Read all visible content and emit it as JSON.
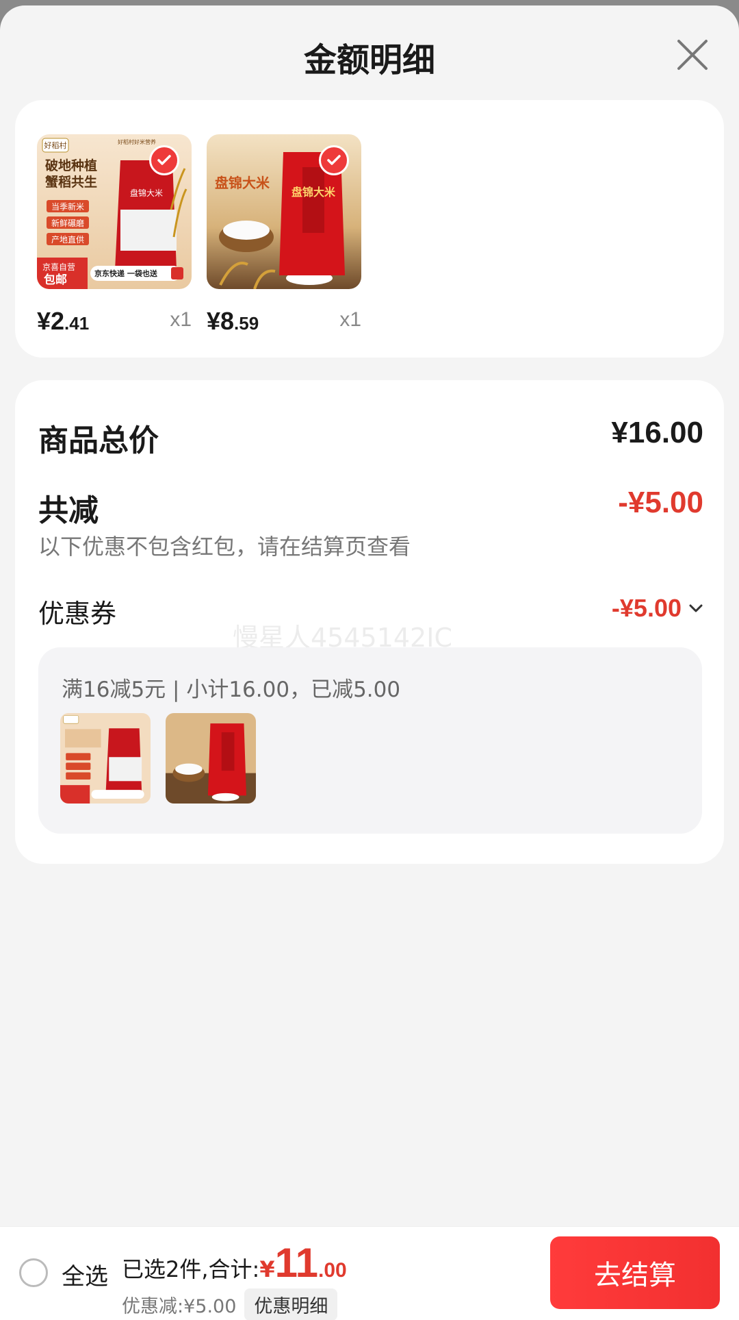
{
  "header": {
    "title": "金额明细",
    "close_icon": "close-icon"
  },
  "products": [
    {
      "pack_brand": "好稻村",
      "slogan_line1": "破地种植",
      "slogan_line2": "蟹稻共生",
      "tags": [
        "当季新米",
        "新鲜碾磨",
        "产地直供"
      ],
      "bag_label": "盘锦大米",
      "corner_badge_line1": "京喜自营",
      "corner_badge_line2": "包邮",
      "delivery_text": "京东快递 一袋也送",
      "top_banner": "好稻村好米营养",
      "price_int": "¥2",
      "price_dec": ".41",
      "qty": "x1",
      "selected_icon": "check-icon"
    },
    {
      "headline": "盘锦大米",
      "bag_label": "盘锦大米",
      "price_int": "¥8",
      "price_dec": ".59",
      "qty": "x1",
      "selected_icon": "check-icon"
    }
  ],
  "summary": {
    "total_label": "商品总价",
    "total_value": "¥16.00",
    "discount_label": "共减",
    "discount_value": "-¥5.00",
    "note": "以下优惠不包含红包，请在结算页查看",
    "coupon_label": "优惠券",
    "coupon_value": "-¥5.00",
    "coupon_chevron_icon": "chevron-down-icon",
    "watermark": "慢星人4545142IC",
    "coupon_detail": "满16减5元 | 小计16.00，已减5.00"
  },
  "bottom_bar": {
    "select_all": "全选",
    "selected_text": "已选2件,合计:",
    "total_yen": "¥",
    "total_int": "11",
    "total_dec": ".00",
    "discount_text": "优惠减:¥5.00",
    "detail_button": "优惠明细",
    "checkout_button": "去结算"
  },
  "colors": {
    "accent_red": "#e03a2e",
    "checkout_red": "#f23030",
    "background": "#f4f4f4"
  }
}
